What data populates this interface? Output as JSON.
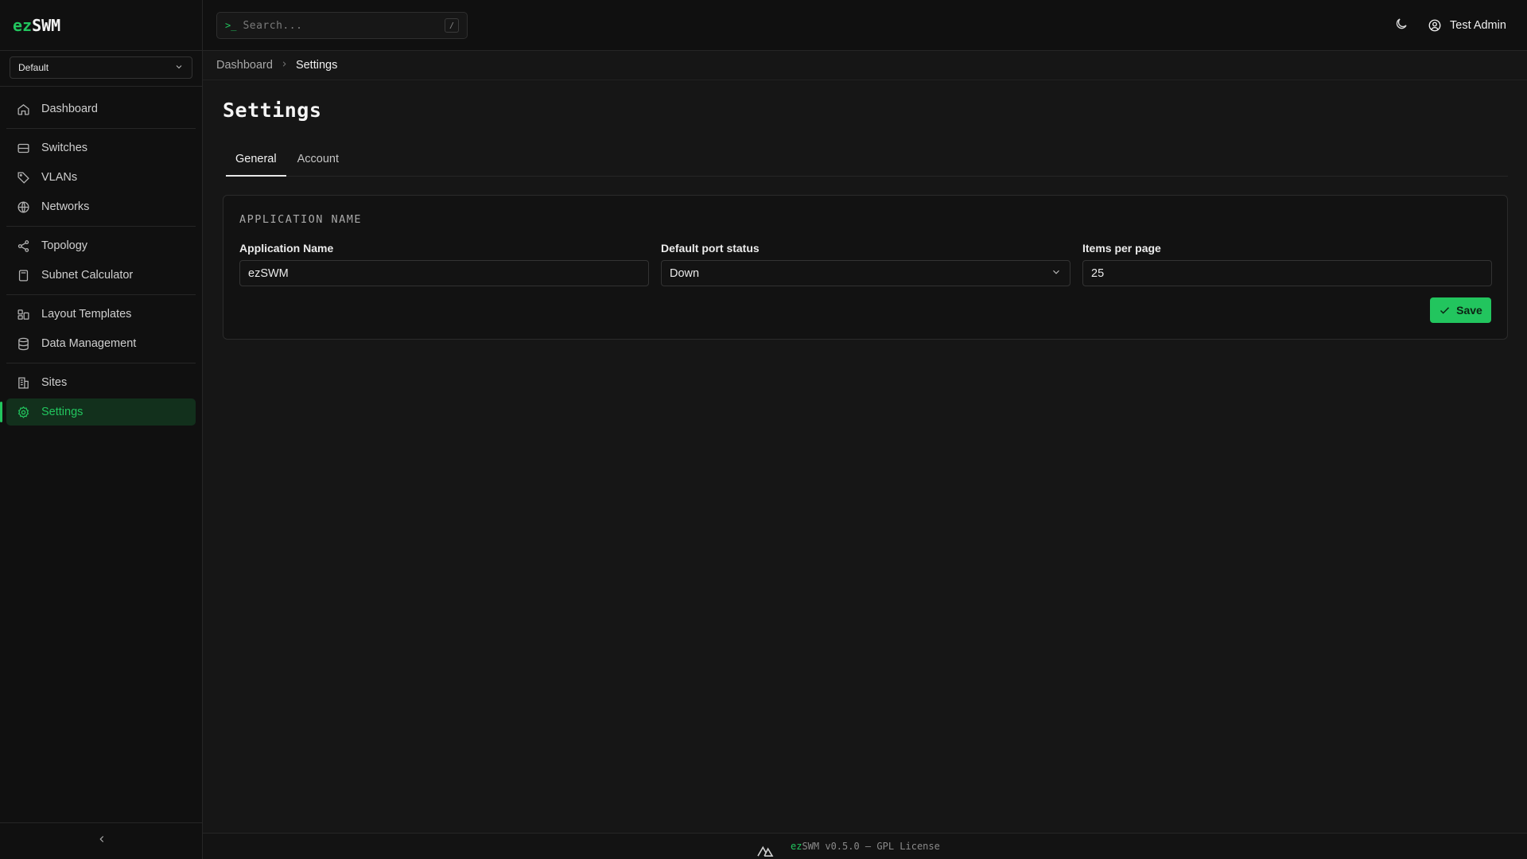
{
  "app": {
    "logo_ez": "ez",
    "logo_swm": "SWM"
  },
  "site_select": {
    "value": "Default"
  },
  "sidebar": {
    "groups": [
      [
        {
          "label": "Dashboard",
          "icon": "home-icon"
        }
      ],
      [
        {
          "label": "Switches",
          "icon": "server-icon"
        },
        {
          "label": "VLANs",
          "icon": "tag-icon"
        },
        {
          "label": "Networks",
          "icon": "globe-icon"
        }
      ],
      [
        {
          "label": "Topology",
          "icon": "share-icon"
        },
        {
          "label": "Subnet Calculator",
          "icon": "calculator-icon"
        }
      ],
      [
        {
          "label": "Layout Templates",
          "icon": "layout-icon"
        },
        {
          "label": "Data Management",
          "icon": "database-icon"
        }
      ],
      [
        {
          "label": "Sites",
          "icon": "building-icon"
        },
        {
          "label": "Settings",
          "icon": "gear-icon",
          "active": true
        }
      ]
    ]
  },
  "search": {
    "prompt": ">_",
    "placeholder": "Search...",
    "shortcut": "/"
  },
  "user": {
    "name": "Test Admin"
  },
  "breadcrumb": {
    "root": "Dashboard",
    "current": "Settings"
  },
  "page": {
    "title": "Settings"
  },
  "tabs": [
    {
      "label": "General",
      "active": true
    },
    {
      "label": "Account",
      "active": false
    }
  ],
  "card": {
    "section_title": "APPLICATION NAME",
    "fields": {
      "app_name": {
        "label": "Application Name",
        "value": "ezSWM"
      },
      "port_status": {
        "label": "Default port status",
        "value": "Down"
      },
      "items_per_page": {
        "label": "Items per page",
        "value": "25"
      }
    },
    "save_label": "Save"
  },
  "footer": {
    "ez": "ez",
    "text": "SWM v0.5.0 — GPL License"
  },
  "colors": {
    "accent": "#22c55e",
    "background": "#161616",
    "sidebar": "#101010"
  }
}
